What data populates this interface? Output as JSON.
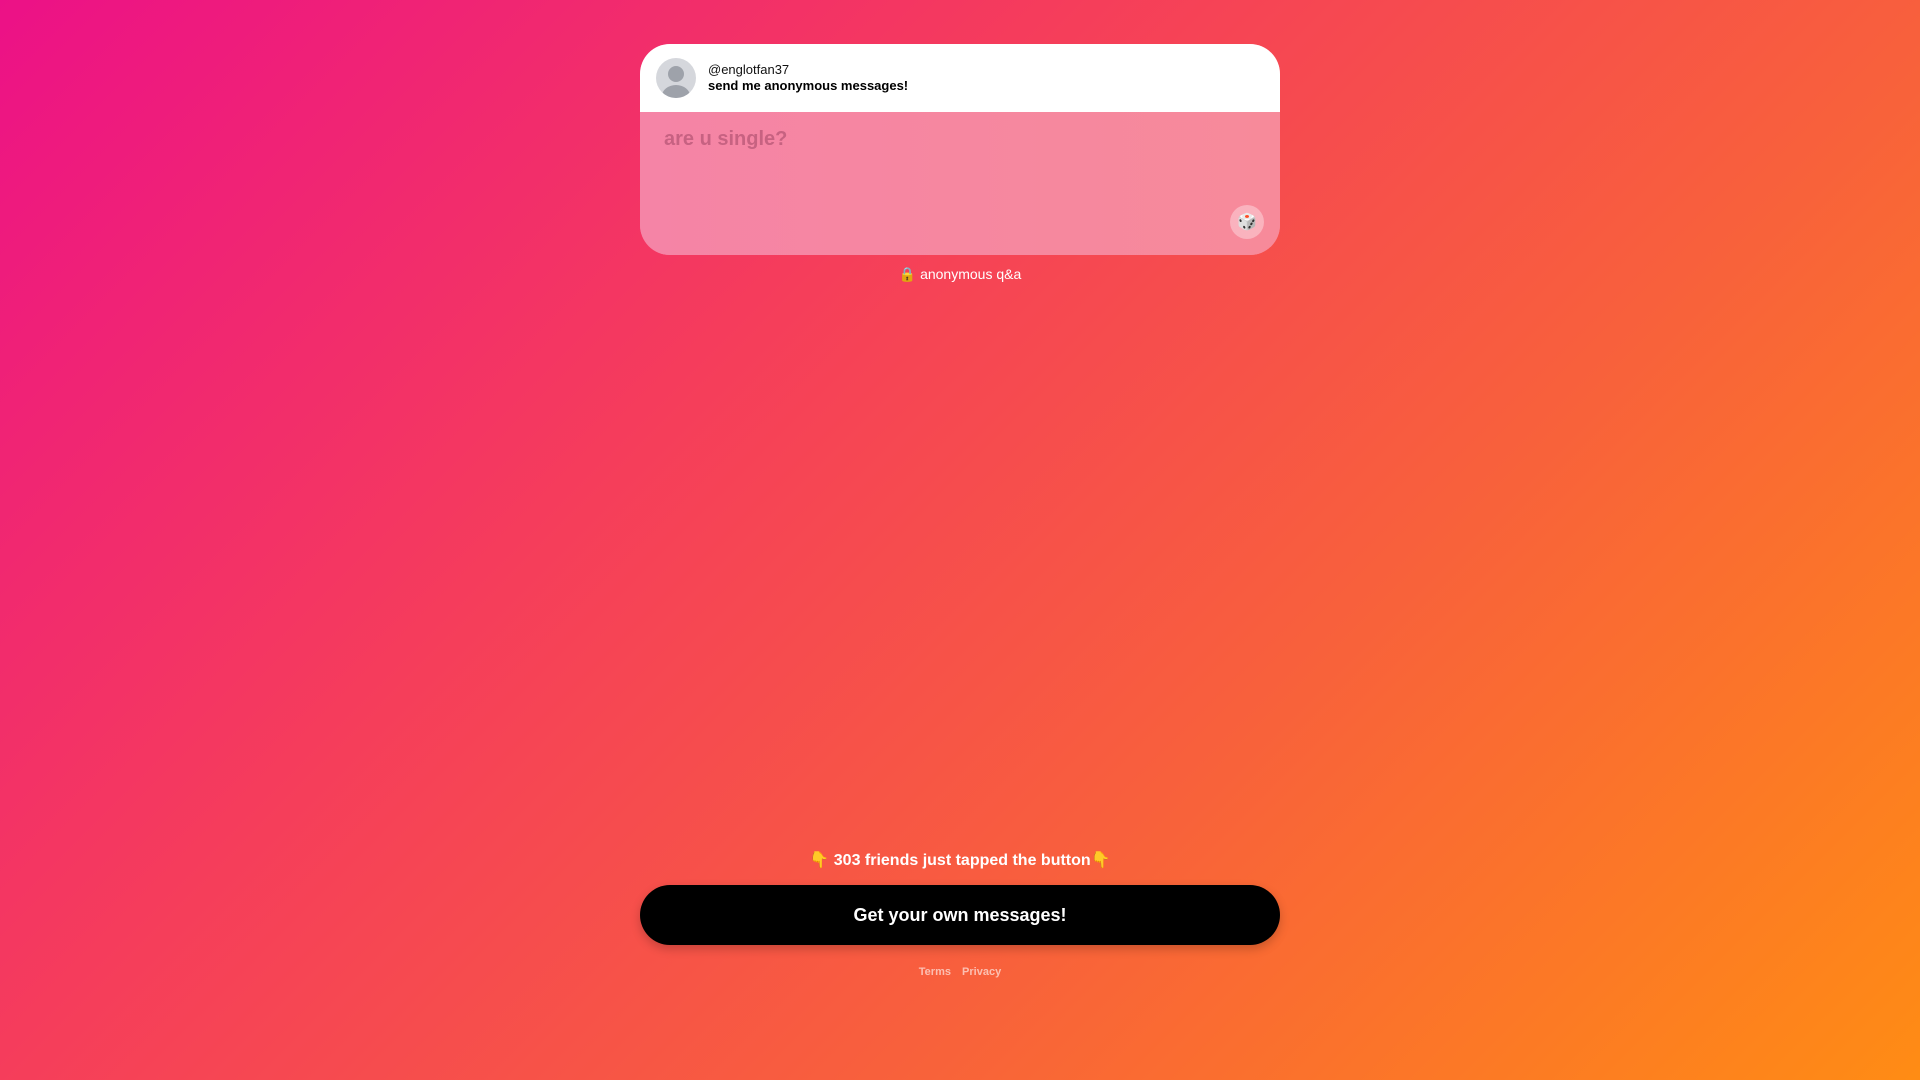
{
  "profile": {
    "username": "@englotfan37",
    "prompt": "send me anonymous messages!"
  },
  "message": {
    "placeholder": "are u single?",
    "dice_icon": "dice-icon"
  },
  "anon_label": {
    "lock_icon": "🔒",
    "text": "anonymous q&a"
  },
  "promo": {
    "pointer_icon": "👇",
    "text": "303 friends just tapped the button"
  },
  "cta": {
    "label": "Get your own messages!"
  },
  "footer": {
    "terms": "Terms",
    "privacy": "Privacy"
  },
  "colors": {
    "gradient_start": "#ec1187",
    "gradient_end": "#ff8c14",
    "cta_background": "#000000",
    "message_area": "#f6869f"
  }
}
